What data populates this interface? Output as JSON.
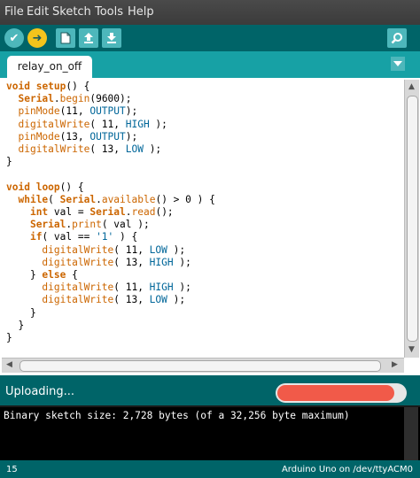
{
  "menu": {
    "file": "File",
    "edit": "Edit",
    "sketch": "Sketch",
    "tools": "Tools",
    "help": "Help"
  },
  "toolbar": {
    "verify_icon": "check-icon",
    "upload_icon": "arrow-right-icon",
    "new_icon": "new-document-icon",
    "open_icon": "open-arrow-up-icon",
    "save_icon": "save-arrow-down-icon",
    "monitor_icon": "magnifier-icon"
  },
  "tabs": [
    {
      "label": "relay_on_off"
    }
  ],
  "editor": {
    "lines": [
      "void setup() {",
      "  Serial.begin(9600);",
      "  pinMode(11, OUTPUT);",
      "  digitalWrite( 11, HIGH );",
      "  pinMode(13, OUTPUT);",
      "  digitalWrite( 13, LOW );",
      "}",
      "",
      "void loop() {",
      "  while( Serial.available() > 0 ) {",
      "    int val = Serial.read();",
      "    Serial.print( val );",
      "    if( val == '1' ) {",
      "      digitalWrite( 11, LOW );",
      "      digitalWrite( 13, HIGH );",
      "    } else {",
      "      digitalWrite( 11, HIGH );",
      "      digitalWrite( 13, LOW );",
      "    }",
      "  }",
      "}"
    ]
  },
  "status": {
    "text": "Uploading...",
    "progress": 0.92
  },
  "console": {
    "text": "Binary sketch size: 2,728 bytes (of a 32,256 byte maximum)"
  },
  "footer": {
    "line_number": "15",
    "board": "Arduino Uno on /dev/ttyACM0"
  },
  "colors": {
    "teal_dark": "#006468",
    "teal_tab": "#17a1a5",
    "button": "#4db7bb",
    "upload": "#f4c41c",
    "progress": "#f15a49",
    "keyword": "#cc6600",
    "constant": "#006699"
  }
}
